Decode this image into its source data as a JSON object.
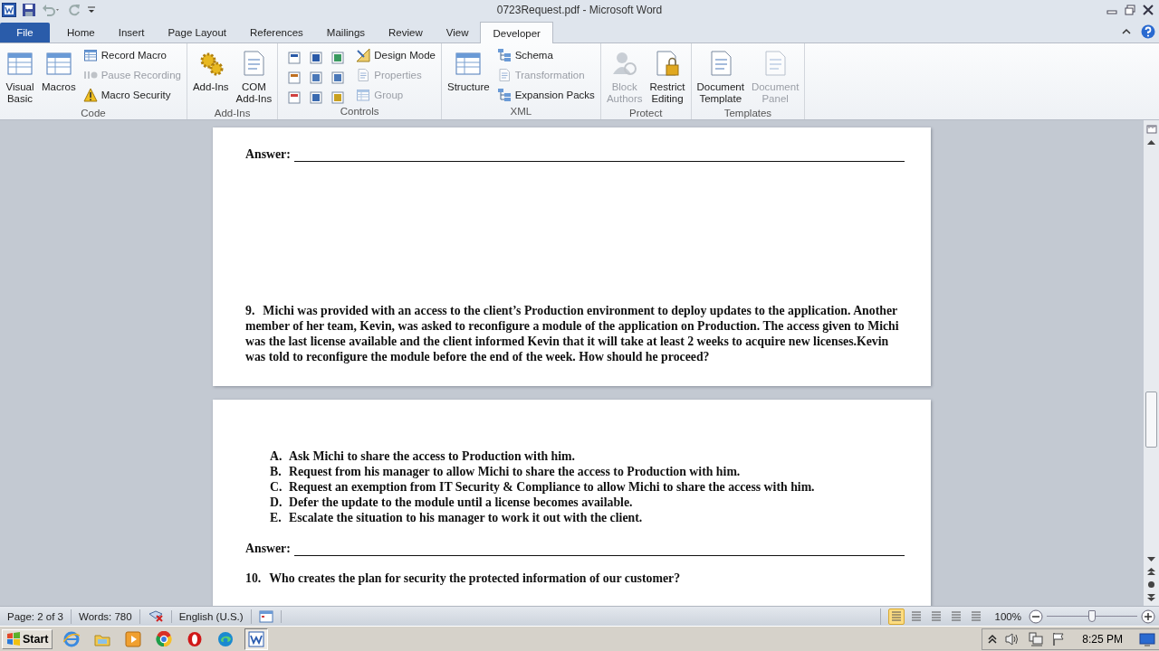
{
  "window": {
    "title": "0723Request.pdf  -  Microsoft Word"
  },
  "tabs": [
    {
      "label": "File",
      "kind": "file",
      "selected": false
    },
    {
      "label": "Home",
      "kind": "tab",
      "selected": false
    },
    {
      "label": "Insert",
      "kind": "tab",
      "selected": false
    },
    {
      "label": "Page Layout",
      "kind": "tab",
      "selected": false
    },
    {
      "label": "References",
      "kind": "tab",
      "selected": false
    },
    {
      "label": "Mailings",
      "kind": "tab",
      "selected": false
    },
    {
      "label": "Review",
      "kind": "tab",
      "selected": false
    },
    {
      "label": "View",
      "kind": "tab",
      "selected": false
    },
    {
      "label": "Developer",
      "kind": "tab",
      "selected": true
    }
  ],
  "ribbon": {
    "groups": [
      {
        "label": "Code",
        "items": [
          {
            "kind": "large",
            "label": "Visual\nBasic",
            "disabled": false
          },
          {
            "kind": "large",
            "label": "Macros",
            "disabled": false
          },
          {
            "kind": "stack",
            "buttons": [
              {
                "label": "Record Macro",
                "disabled": false
              },
              {
                "label": "Pause Recording",
                "disabled": true
              },
              {
                "label": "Macro Security",
                "disabled": false
              }
            ]
          }
        ]
      },
      {
        "label": "Add-Ins",
        "items": [
          {
            "kind": "large",
            "label": "Add-Ins",
            "disabled": false
          },
          {
            "kind": "large",
            "label": "COM\nAdd-Ins",
            "disabled": false
          }
        ]
      },
      {
        "label": "Controls",
        "items": [
          {
            "kind": "grid",
            "buttons": [
              {
                "disabled": false
              },
              {
                "disabled": false
              },
              {
                "disabled": false
              },
              {
                "disabled": false
              },
              {
                "disabled": false
              },
              {
                "disabled": false
              },
              {
                "disabled": false
              },
              {
                "disabled": false
              },
              {
                "disabled": false
              }
            ]
          },
          {
            "kind": "stack",
            "buttons": [
              {
                "label": "Design Mode",
                "disabled": false
              },
              {
                "label": "Properties",
                "disabled": true
              },
              {
                "label": "Group",
                "disabled": true
              }
            ]
          }
        ]
      },
      {
        "label": "XML",
        "items": [
          {
            "kind": "large",
            "label": "Structure",
            "disabled": false
          },
          {
            "kind": "stack",
            "buttons": [
              {
                "label": "Schema",
                "disabled": false
              },
              {
                "label": "Transformation",
                "disabled": true
              },
              {
                "label": "Expansion Packs",
                "disabled": false
              }
            ]
          }
        ]
      },
      {
        "label": "Protect",
        "items": [
          {
            "kind": "large",
            "label": "Block\nAuthors",
            "disabled": true
          },
          {
            "kind": "large",
            "label": "Restrict\nEditing",
            "disabled": false
          }
        ]
      },
      {
        "label": "Templates",
        "items": [
          {
            "kind": "large",
            "label": "Document\nTemplate",
            "disabled": false
          },
          {
            "kind": "large",
            "label": "Document\nPanel",
            "disabled": true
          }
        ]
      }
    ]
  },
  "document": {
    "pages": [
      {
        "blocks": [
          {
            "kind": "answer",
            "label": "Answer:"
          },
          {
            "kind": "question",
            "number": "9.",
            "text": "Michi was provided with an access to the client’s Production environment to deploy updates to the application. Another member of her team, Kevin, was asked to reconfigure a module of the application on Production. The access given to Michi was the last license available and the client informed Kevin that it will take at least 2 weeks to acquire new licenses.Kevin was told to reconfigure the module before the end of the week. How should he proceed?"
          }
        ]
      },
      {
        "blocks": [
          {
            "kind": "options",
            "items": [
              {
                "letter": "A.",
                "text": "Ask Michi to share the access to Production with him."
              },
              {
                "letter": "B.",
                "text": "Request from his manager to allow Michi to share the access to Production with him."
              },
              {
                "letter": "C.",
                "text": "Request an exemption from IT Security & Compliance to allow Michi to share the access with him."
              },
              {
                "letter": "D.",
                "text": "Defer the update to the module until a license becomes available."
              },
              {
                "letter": "E.",
                "text": "Escalate the situation to his manager to work it out with the client."
              }
            ]
          },
          {
            "kind": "answer",
            "label": "Answer:"
          },
          {
            "kind": "question",
            "number": "10.",
            "text": "Who creates the plan for security the protected information of our customer?"
          }
        ]
      }
    ]
  },
  "status_bar": {
    "page": "Page: 2 of 3",
    "words": "Words: 780",
    "language": "English (U.S.)",
    "views": [
      {
        "selected": true
      },
      {
        "selected": false
      },
      {
        "selected": false
      },
      {
        "selected": false
      },
      {
        "selected": false
      }
    ],
    "zoom": {
      "reading": "100%",
      "level": 0.5
    }
  },
  "taskbar": {
    "start": "Start",
    "apps": [
      {
        "selected": false
      },
      {
        "selected": false
      },
      {
        "selected": false
      },
      {
        "selected": false
      },
      {
        "selected": false
      },
      {
        "selected": false
      },
      {
        "selected": true
      }
    ],
    "clock": "8:25 PM"
  }
}
